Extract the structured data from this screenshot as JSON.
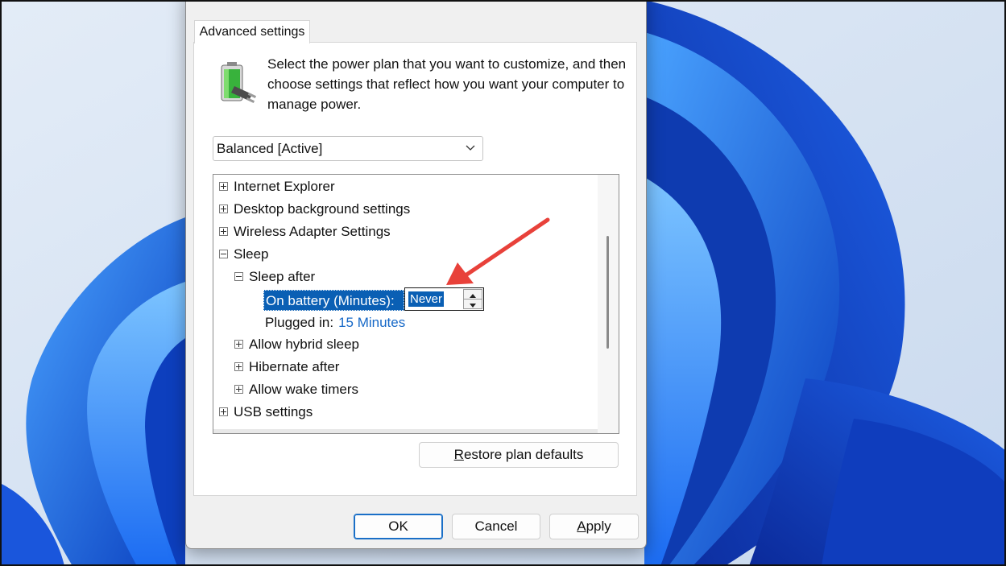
{
  "dialog": {
    "tab_label": "Advanced settings",
    "intro_text": "Select the power plan that you want to customize, and then choose settings that reflect how you want your computer to manage power.",
    "plan_select": {
      "value": "Balanced [Active]"
    }
  },
  "tree": {
    "items": [
      {
        "label": "Internet Explorer",
        "state": "collapsed"
      },
      {
        "label": "Desktop background settings",
        "state": "collapsed"
      },
      {
        "label": "Wireless Adapter Settings",
        "state": "collapsed"
      },
      {
        "label": "Sleep",
        "state": "expanded"
      },
      {
        "label": "Sleep after",
        "state": "expanded"
      },
      {
        "label": "Allow hybrid sleep",
        "state": "collapsed"
      },
      {
        "label": "Hibernate after",
        "state": "collapsed"
      },
      {
        "label": "Allow wake timers",
        "state": "collapsed"
      },
      {
        "label": "USB settings",
        "state": "collapsed"
      }
    ],
    "on_battery": {
      "label": "On battery (Minutes):",
      "value": "Never"
    },
    "plugged_in": {
      "label": "Plugged in:",
      "value": "15 Minutes"
    }
  },
  "buttons": {
    "restore_label_key": "R",
    "restore_label_rest": "estore plan defaults",
    "ok": "OK",
    "cancel": "Cancel",
    "apply_key": "A",
    "apply_rest": "pply"
  },
  "colors": {
    "selection": "#0a5fb4",
    "link": "#1668c7",
    "annotation_arrow": "#e8413a",
    "wallpaper_accent": "#1f62e0"
  },
  "icons": [
    "power-plan-battery-icon",
    "chevron-down-icon",
    "spin-up-icon",
    "spin-down-icon",
    "annotation-arrow"
  ]
}
